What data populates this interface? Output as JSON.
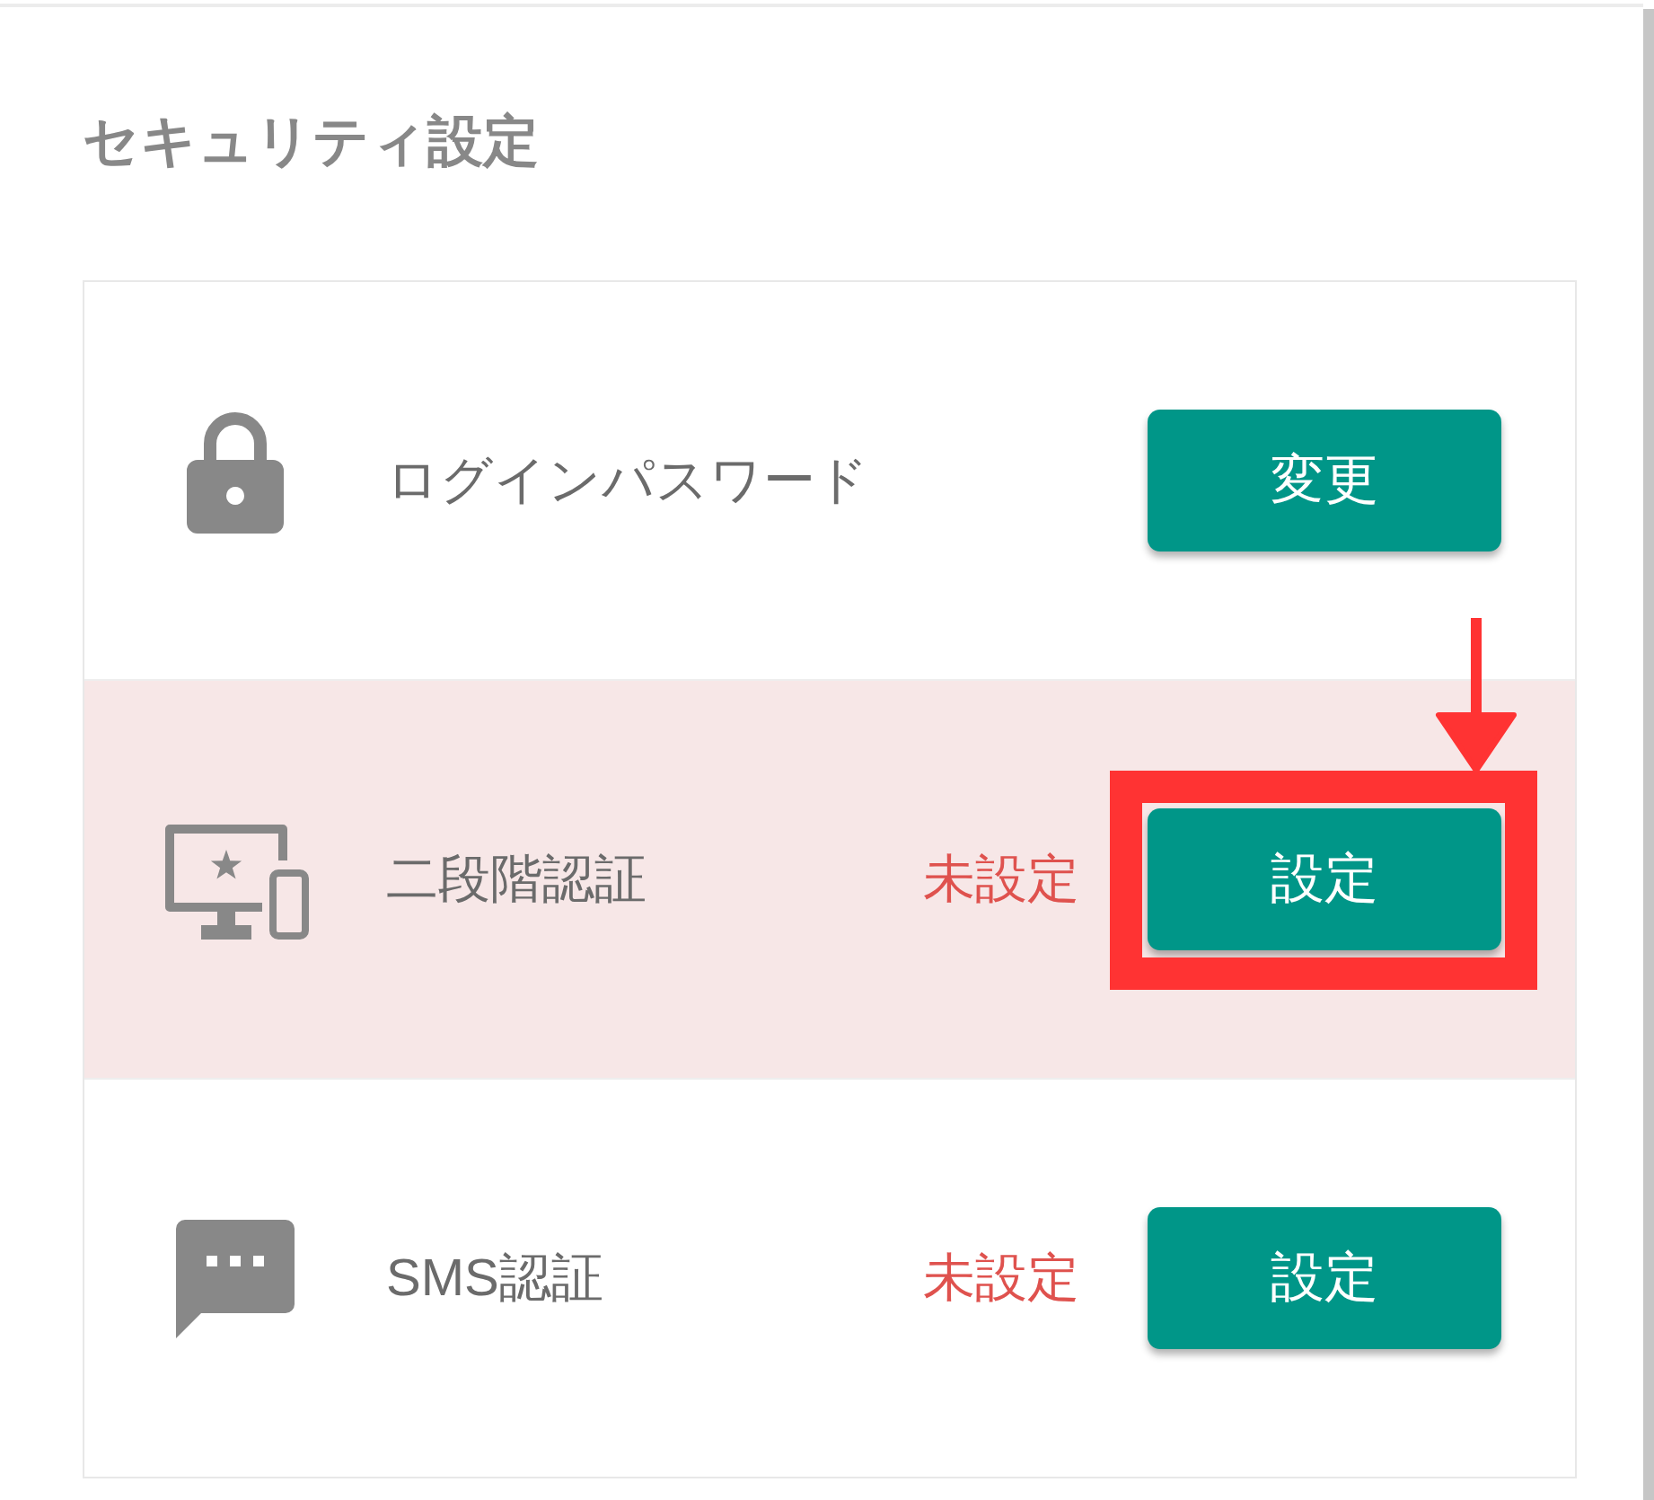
{
  "title": "セキュリティ設定",
  "items": [
    {
      "kind": "password",
      "label": "ログインパスワード",
      "button": "変更",
      "highlighted": false
    },
    {
      "kind": "two_step",
      "label": "二段階認証",
      "status": "未設定",
      "button": "設定",
      "highlighted": true
    },
    {
      "kind": "sms",
      "label": "SMS認証",
      "status": "未設定",
      "button": "設定",
      "highlighted": false
    }
  ]
}
